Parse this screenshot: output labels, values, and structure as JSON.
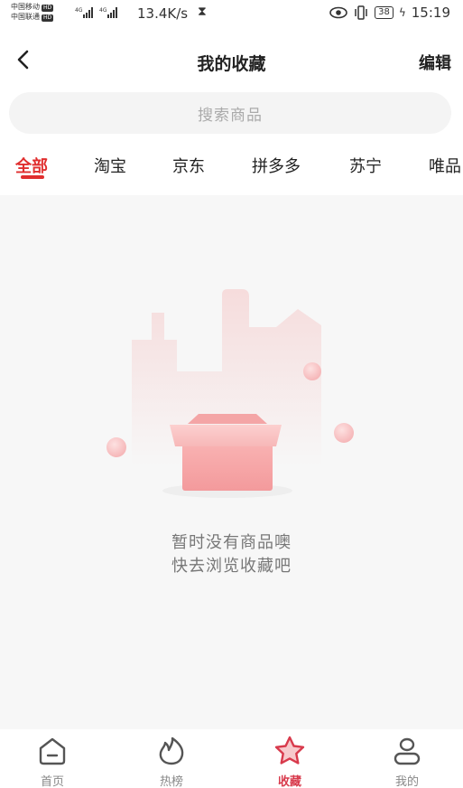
{
  "status_bar": {
    "carrier_1": "中国移动",
    "carrier_2": "中国联通",
    "hd": "HD",
    "net_speed": "13.4K/s",
    "battery": "38",
    "time": "15:19"
  },
  "header": {
    "title": "我的收藏",
    "edit_label": "编辑"
  },
  "search": {
    "placeholder": "搜索商品"
  },
  "tabs": [
    {
      "label": "全部",
      "active": true
    },
    {
      "label": "淘宝"
    },
    {
      "label": "京东"
    },
    {
      "label": "拼多多"
    },
    {
      "label": "苏宁"
    },
    {
      "label": "唯品"
    }
  ],
  "empty_state": {
    "line1": "暂时没有商品噢",
    "line2": "快去浏览收藏吧"
  },
  "bottom_nav": [
    {
      "label": "首页",
      "icon": "home-icon"
    },
    {
      "label": "热榜",
      "icon": "flame-icon"
    },
    {
      "label": "收藏",
      "icon": "star-icon",
      "active": true
    },
    {
      "label": "我的",
      "icon": "person-icon"
    }
  ],
  "colors": {
    "accent": "#e02e2e",
    "nav_active": "#d83a4c",
    "background": "#f7f7f7"
  }
}
